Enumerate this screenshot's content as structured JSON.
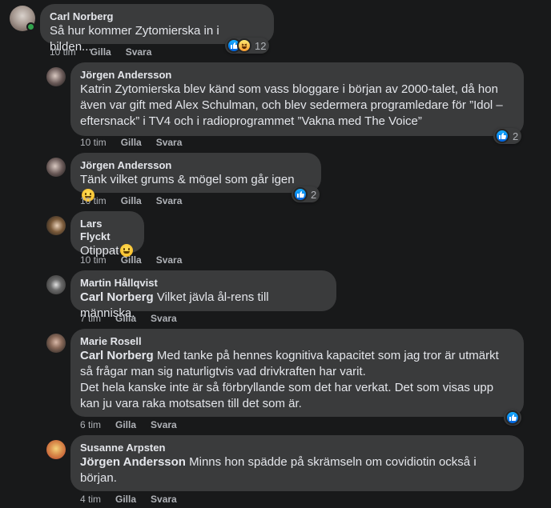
{
  "comments": [
    {
      "author": "Carl Norberg",
      "text": "Så hur kommer Zytomierska in i bilden...",
      "time": "10 tim",
      "like": "Gilla",
      "reply": "Svara",
      "reaction_count": "12"
    },
    {
      "author": "Jörgen Andersson",
      "text": "Katrin Zytomierska blev känd som vass bloggare i början av 2000-talet, då hon även var gift med Alex Schulman, och blev sedermera programledare för ”Idol – eftersnack” i TV4 och i radioprogrammet ”Vakna med The Voice”",
      "time": "10 tim",
      "like": "Gilla",
      "reply": "Svara",
      "reaction_count": "2"
    },
    {
      "author": "Jörgen Andersson",
      "text": "Tänk vilket grums & mögel som går igen",
      "time": "10 tim",
      "like": "Gilla",
      "reply": "Svara",
      "reaction_count": "2"
    },
    {
      "author": "Lars Flyckt",
      "text": "Otippat",
      "time": "10 tim",
      "like": "Gilla",
      "reply": "Svara"
    },
    {
      "author": "Martin Hållqvist",
      "mention": "Carl Norberg",
      "text": "Vilket jävla ål-rens till människa.",
      "time": "7 tim",
      "like": "Gilla",
      "reply": "Svara"
    },
    {
      "author": "Marie Rosell",
      "mention": "Carl Norberg",
      "text": "Med tanke på hennes kognitiva kapacitet som jag tror är utmärkt så frågar man sig naturligtvis vad drivkraften har varit.",
      "text2": "Det hela kanske inte är så förbryllande som det har verkat. Det som visas upp kan ju vara raka motsatsen till det som är.",
      "time": "6 tim",
      "like": "Gilla",
      "reply": "Svara"
    },
    {
      "author": "Susanne Arpsten",
      "mention": "Jörgen Andersson",
      "text": "Minns hon spädde på skrämseln om covidiotin också i början.",
      "time": "4 tim",
      "like": "Gilla",
      "reply": "Svara"
    }
  ],
  "colors": {
    "background": "#18191a",
    "bubble": "#3a3b3c",
    "meta": "#b0b3b8",
    "like_blue": "#1877f2",
    "online": "#31a24c"
  },
  "icons": [
    "like-icon",
    "haha-icon",
    "smile-emoji-icon",
    "grin-emoji-icon",
    "online-status-dot"
  ]
}
